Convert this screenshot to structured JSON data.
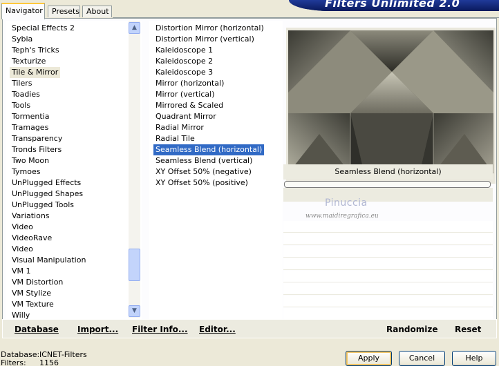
{
  "tabs": [
    {
      "label": "Navigator"
    },
    {
      "label": "Presets"
    },
    {
      "label": "About"
    }
  ],
  "banner_title": "Filters Unlimited 2.0",
  "categories": [
    "Special Effects 2",
    "Sybia",
    "Teph's Tricks",
    "Texturize",
    "Tile & Mirror",
    "Tilers",
    "Toadies",
    "Tools",
    "Tormentia",
    "Tramages",
    "Transparency",
    "Tronds Filters",
    "Two Moon",
    "Tymoes",
    "UnPlugged Effects",
    "UnPlugged Shapes",
    "UnPlugged Tools",
    "Variations",
    "Video",
    "VideoRave",
    "Video",
    "Visual Manipulation",
    "VM 1",
    "VM Distortion",
    "VM Stylize",
    "VM Texture",
    "Willy"
  ],
  "selected_category": "Tile & Mirror",
  "filters": [
    "Distortion Mirror (horizontal)",
    "Distortion Mirror (vertical)",
    "Kaleidoscope 1",
    "Kaleidoscope 2",
    "Kaleidoscope 3",
    "Mirror (horizontal)",
    "Mirror (vertical)",
    "Mirrored & Scaled",
    "Quadrant Mirror",
    "Radial Mirror",
    "Radial Tile",
    "Seamless Blend (horizontal)",
    "Seamless Blend (vertical)",
    "XY Offset 50% (negative)",
    "XY Offset 50% (positive)"
  ],
  "selected_filter": "Seamless Blend (horizontal)",
  "scrollbar": {
    "up_icon": "chevron-up-icon",
    "down_icon": "chevron-down-icon",
    "position": 0.9
  },
  "preview": {
    "filter_name": "Seamless Blend (horizontal)"
  },
  "watermark": {
    "name": "Pinuccia",
    "site": "www.maidiregrafica.eu"
  },
  "links": {
    "database": "Database",
    "import": "Import...",
    "filter_info": "Filter Info...",
    "editor": "Editor...",
    "randomize": "Randomize",
    "reset": "Reset"
  },
  "status": {
    "database_label": "Database:",
    "database_value": "ICNET-Filters",
    "filters_label": "Filters:",
    "filters_value": "1156"
  },
  "buttons": {
    "apply": "Apply",
    "cancel": "Cancel",
    "help": "Help"
  },
  "colors": {
    "selection": "#316ac5",
    "banner": "#0b1f6e",
    "panel": "#ece9d8"
  }
}
